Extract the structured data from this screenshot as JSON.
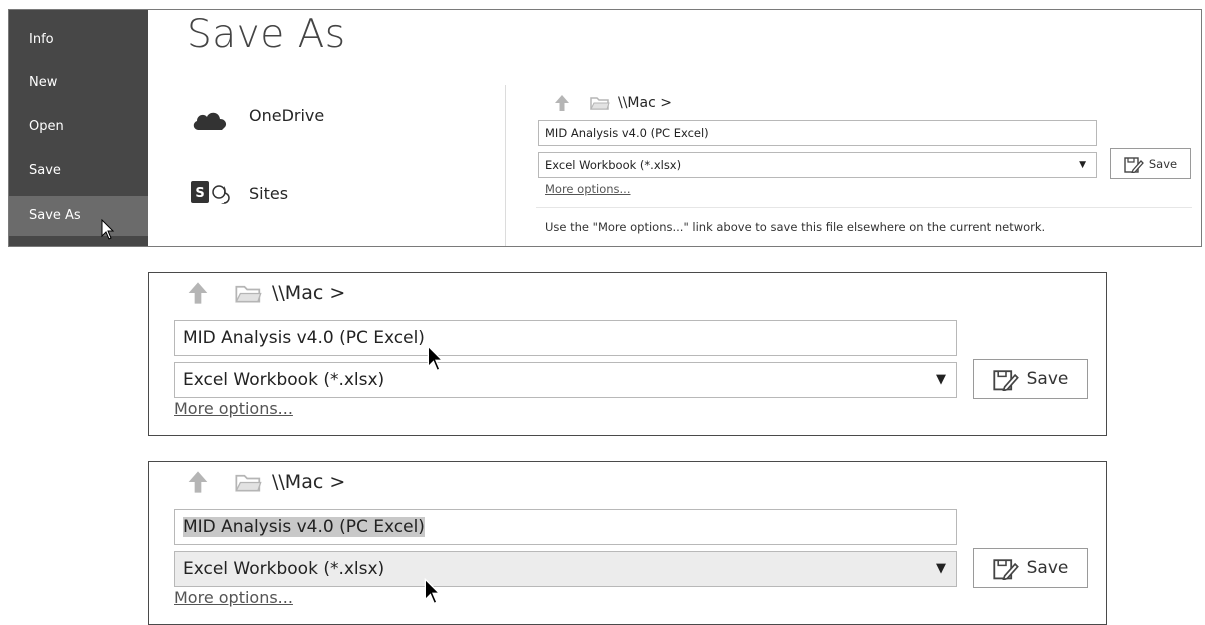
{
  "backstage": {
    "nav": [
      {
        "label": "Info"
      },
      {
        "label": "New"
      },
      {
        "label": "Open"
      },
      {
        "label": "Save"
      },
      {
        "label": "Save As",
        "active": true
      }
    ],
    "title": "Save As",
    "locations": [
      {
        "label": "OneDrive",
        "icon": "cloud-icon"
      },
      {
        "label": "Sites",
        "icon": "sharepoint-icon"
      }
    ],
    "path": "\\\\Mac >",
    "filename": "MID Analysis v4.0 (PC Excel)",
    "filetype": "Excel Workbook (*.xlsx)",
    "save_label": "Save",
    "more_options": "More options...",
    "hint": "Use the \"More options...\" link above to save this file elsewhere on the current network."
  },
  "zoom1": {
    "path": "\\\\Mac >",
    "filename": "MID Analysis v4.0 (PC Excel)",
    "filetype": "Excel Workbook (*.xlsx)",
    "save_label": "Save",
    "more_options": "More options..."
  },
  "zoom2": {
    "path": "\\\\Mac >",
    "filename": "MID Analysis v4.0 (PC Excel)",
    "filetype": "Excel Workbook (*.xlsx)",
    "save_label": "Save",
    "more_options": "More options..."
  },
  "colors": {
    "sidebar": "#474747",
    "sidebar_active": "#6b6b6b",
    "selection": "#c8c8c8"
  }
}
